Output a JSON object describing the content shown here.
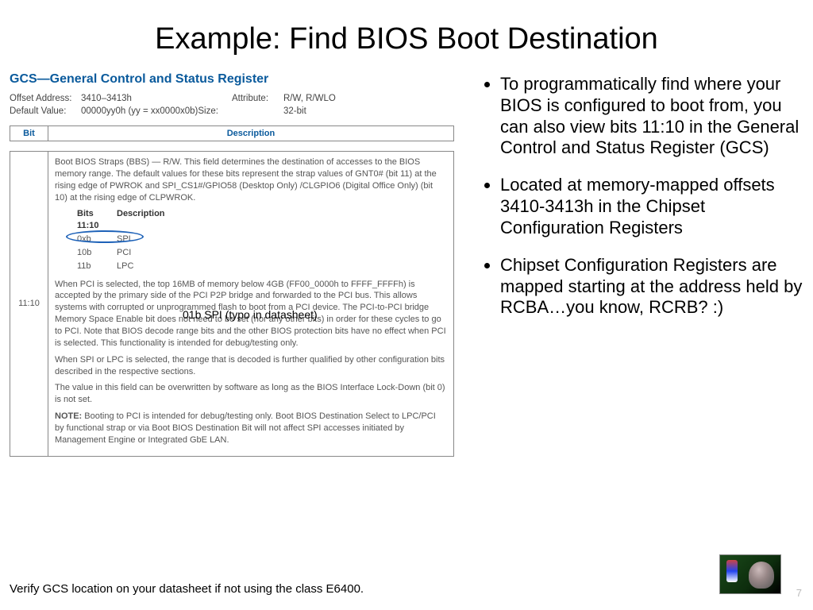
{
  "title": "Example: Find BIOS Boot Destination",
  "bullets": [
    "To programmatically find where your BIOS is configured to boot from, you can also view bits 11:10 in the General Control and Status Register (GCS)",
    "Located at memory-mapped offsets 3410-3413h in the Chipset Configuration Registers",
    "Chipset Configuration Registers are mapped starting at the address held by RCBA…you know, RCRB? :)"
  ],
  "register": {
    "name": "GCS—General Control and Status Register",
    "offset_label": "Offset Address:",
    "offset": "3410–3413h",
    "attribute_label": "Attribute:",
    "attribute": "R/W, R/WLO",
    "default_label": "Default Value:",
    "default": "00000yy0h (yy = xx0000x0b)",
    "size_label": "Size:",
    "size": "32-bit",
    "col_bit": "Bit",
    "col_desc": "Description",
    "bit_range": "11:10",
    "desc_intro": "Boot BIOS Straps (BBS) — R/W. This field determines the destination of accesses to the BIOS memory range. The default values for these bits represent the strap values of GNT0# (bit 11) at the rising edge of PWROK and SPI_CS1#/GPIO58 (Desktop Only) /CLGPIO6 (Digital Office Only) (bit 10) at the rising edge of CLPWROK.",
    "bits_header_a": "Bits 11:10",
    "bits_header_b": "Description",
    "bits_rows": [
      {
        "v": "0xb",
        "d": "SPI"
      },
      {
        "v": "10b",
        "d": "PCI"
      },
      {
        "v": "11b",
        "d": "LPC"
      }
    ],
    "p1": "When PCI is selected, the top 16MB of memory below 4GB (FF00_0000h to FFFF_FFFFh) is accepted by the primary side of the PCI P2P bridge and forwarded to the PCI bus. This allows systems with corrupted or unprogrammed flash to boot from a PCI device. The PCI-to-PCI bridge Memory Space Enable bit does not need to be set (nor any other bits) in order for these cycles to go to PCI. Note that BIOS decode range bits and the other BIOS protection bits have no effect when PCI is selected. This functionality is intended for debug/testing only.",
    "p2": "When SPI or LPC is selected, the range that is decoded is further qualified by other configuration bits described in the respective sections.",
    "p3": "The value in this field can be overwritten by software as long as the BIOS Interface Lock-Down (bit 0) is not set.",
    "note_label": "NOTE:",
    "note": "Booting to PCI is intended for debug/testing only. Boot BIOS Destination Select to LPC/PCI by functional strap or via Boot BIOS Destination Bit will not affect SPI accesses initiated by Management Engine or Integrated GbE LAN."
  },
  "annotation": "01b  SPI (typo in datasheet)",
  "footer": "Verify GCS location on your datasheet if not using the class E6400.",
  "page": "7"
}
